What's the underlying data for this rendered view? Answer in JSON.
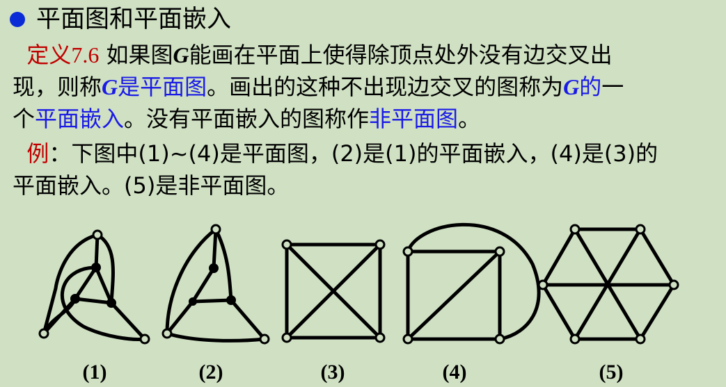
{
  "title": "平面图和平面嵌入",
  "definition": {
    "label": "定义",
    "number": "7.6",
    "l1_a": " 如果图",
    "G": "G",
    "l1_b": "能画在平面上使得除顶点处外没有边交叉出",
    "l2_a": "现，则称",
    "l2_term": "是平面图",
    "l2_b": "。画出的这种不出现边交叉的图称为",
    "l2_term2": "的",
    "l2_c": "一",
    "l3_a": "个",
    "l3_term": "平面嵌入",
    "l3_b": "。没有平面嵌入的图称作",
    "l3_term2": "非平面图",
    "l3_c": "。"
  },
  "example": {
    "label": "例",
    "l1": "：下图中(1)~(4)是平面图，(2)是(1)的平面嵌入，(4)是(3)的",
    "l2": "平面嵌入。(5)是非平面图。"
  },
  "figure_labels": [
    "(1)",
    "(2)",
    "(3)",
    "(4)",
    "(5)"
  ],
  "colors": {
    "background": "#cfe0c3",
    "bullet": "#0b2bd6",
    "term_red": "#c00000",
    "term_blue": "#1a1ae6"
  }
}
